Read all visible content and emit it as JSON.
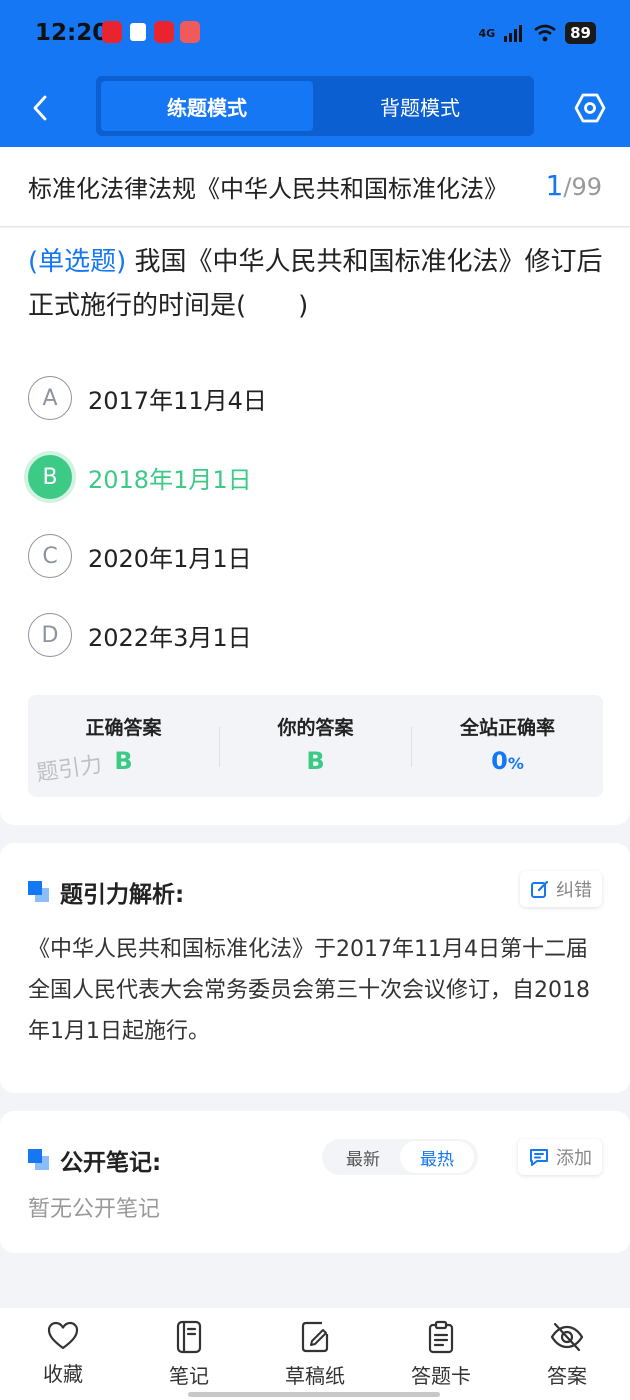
{
  "status_bar": {
    "time": "12:20",
    "network": "4G",
    "battery": "89"
  },
  "nav": {
    "modes": [
      "练题模式",
      "背题模式"
    ],
    "active_mode_index": 0
  },
  "title_row": {
    "chapter": "标准化法律法规《中华人民共和国标准化法》",
    "current": "1",
    "total": "/99"
  },
  "question": {
    "type": "(单选题)",
    "text": " 我国《中华人民共和国标准化法》修订后正式施行的时间是(　　)",
    "options": [
      {
        "letter": "A",
        "text": "2017年11月4日"
      },
      {
        "letter": "B",
        "text": "2018年1月1日"
      },
      {
        "letter": "C",
        "text": "2020年1月1日"
      },
      {
        "letter": "D",
        "text": "2022年3月1日"
      }
    ],
    "selected_letter": "B"
  },
  "stats": {
    "correct_label": "正确答案",
    "correct_value": "B",
    "yours_label": "你的答案",
    "yours_value": "B",
    "rate_label": "全站正确率",
    "rate_value": "0",
    "rate_unit": "%",
    "watermark": "题引力"
  },
  "analysis": {
    "title": "题引力解析:",
    "report_label": "纠错",
    "text": "《中华人民共和国标准化法》于2017年11月4日第十二届全国人民代表大会常务委员会第三十次会议修订，自2018年1月1日起施行。"
  },
  "notes": {
    "title": "公开笔记:",
    "sort_options": [
      "最新",
      "最热"
    ],
    "active_sort_index": 1,
    "add_label": "添加",
    "empty_text": "暂无公开笔记"
  },
  "bottom_tabs": [
    "收藏",
    "笔记",
    "草稿纸",
    "答题卡",
    "答案"
  ],
  "colors": {
    "primary": "#1677f5",
    "correct": "#3cca86",
    "header_dark": "#0c5fd0"
  }
}
